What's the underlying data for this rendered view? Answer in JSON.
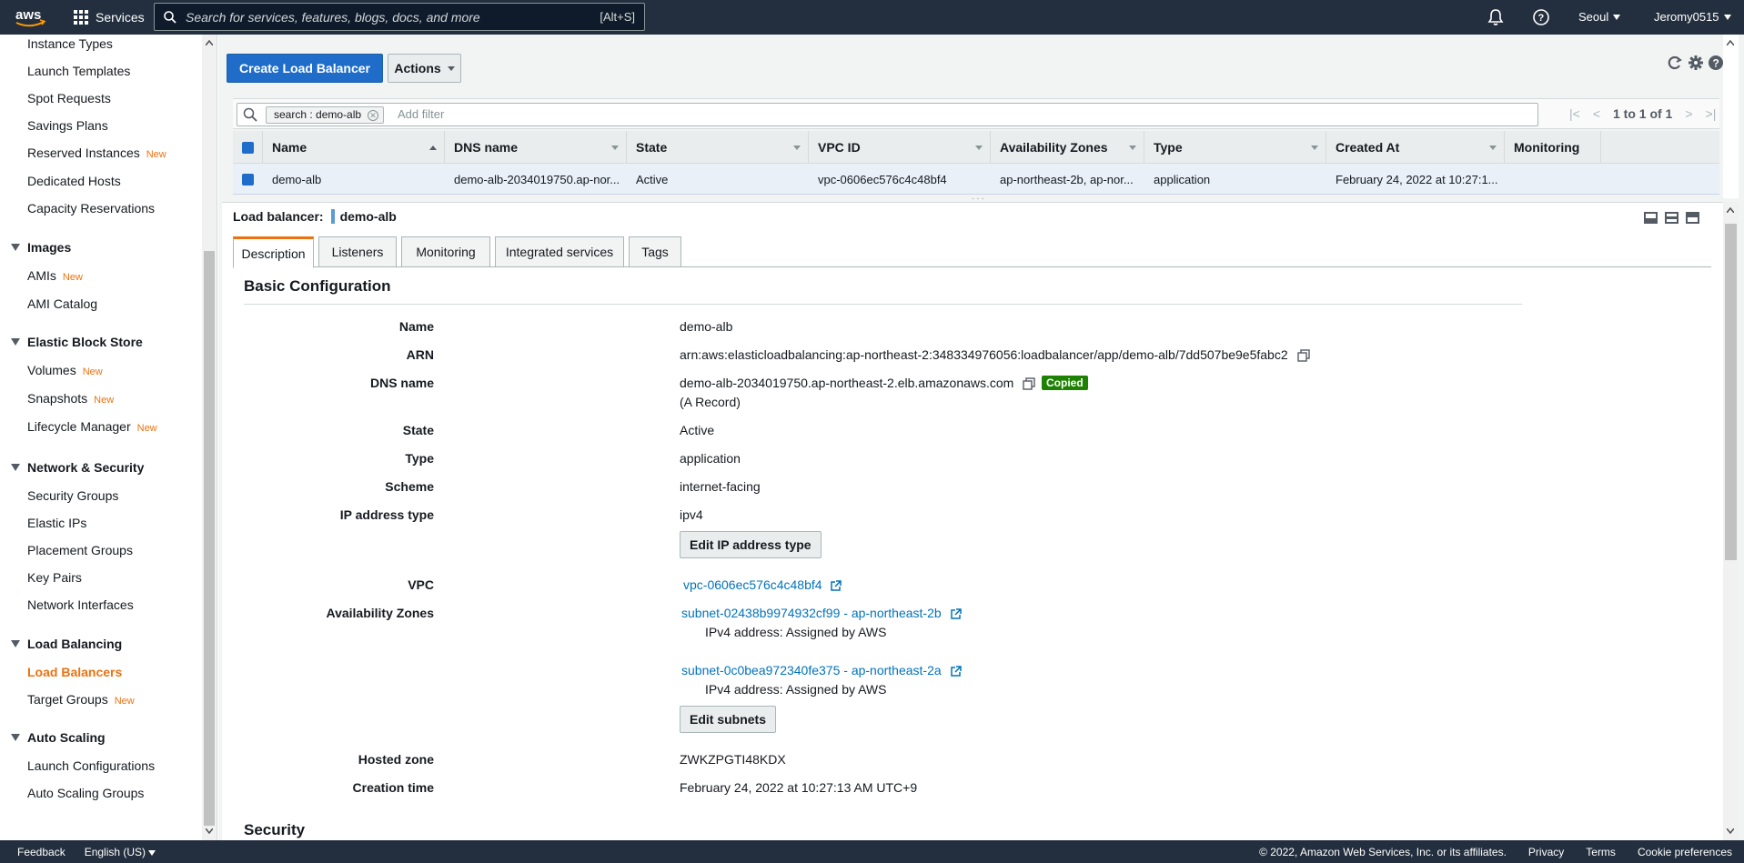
{
  "topnav": {
    "logo_text": "aws",
    "services_label": "Services",
    "search_placeholder": "Search for services, features, blogs, docs, and more",
    "search_shortcut": "[Alt+S]",
    "region": "Seoul",
    "account": "Jeromy0515"
  },
  "sidebar": {
    "new_badge": "New",
    "items": [
      {
        "label": "Instance Types",
        "new": false
      },
      {
        "label": "Launch Templates",
        "new": false
      },
      {
        "label": "Spot Requests",
        "new": false
      },
      {
        "label": "Savings Plans",
        "new": false
      },
      {
        "label": "Reserved Instances",
        "new": true
      },
      {
        "label": "Dedicated Hosts",
        "new": false
      },
      {
        "label": "Capacity Reservations",
        "new": false
      }
    ],
    "sections": {
      "images": {
        "title": "Images",
        "items": [
          {
            "label": "AMIs",
            "new": true
          },
          {
            "label": "AMI Catalog",
            "new": false
          }
        ]
      },
      "ebs": {
        "title": "Elastic Block Store",
        "items": [
          {
            "label": "Volumes",
            "new": true
          },
          {
            "label": "Snapshots",
            "new": true
          },
          {
            "label": "Lifecycle Manager",
            "new": true
          }
        ]
      },
      "network": {
        "title": "Network & Security",
        "items": [
          {
            "label": "Security Groups"
          },
          {
            "label": "Elastic IPs"
          },
          {
            "label": "Placement Groups"
          },
          {
            "label": "Key Pairs"
          },
          {
            "label": "Network Interfaces"
          }
        ]
      },
      "lb": {
        "title": "Load Balancing",
        "items": [
          {
            "label": "Load Balancers",
            "active": true
          },
          {
            "label": "Target Groups",
            "new": true
          }
        ]
      },
      "asg": {
        "title": "Auto Scaling",
        "items": [
          {
            "label": "Launch Configurations"
          },
          {
            "label": "Auto Scaling Groups"
          }
        ]
      }
    }
  },
  "toolbar": {
    "create_label": "Create Load Balancer",
    "actions_label": "Actions"
  },
  "filter": {
    "chip": "search : demo-alb",
    "placeholder": "Add filter",
    "pager_text": "1 to 1 of 1"
  },
  "table": {
    "columns": [
      "Name",
      "DNS name",
      "State",
      "VPC ID",
      "Availability Zones",
      "Type",
      "Created At",
      "Monitoring"
    ],
    "rows": [
      [
        "demo-alb",
        "demo-alb-2034019750.ap-nor...",
        "Active",
        "vpc-0606ec576c4c48bf4",
        "ap-northeast-2b, ap-nor...",
        "application",
        "February 24, 2022 at 10:27:1...",
        ""
      ]
    ]
  },
  "details": {
    "title_prefix": "Load balancer:",
    "title_name": "demo-alb",
    "tabs": [
      "Description",
      "Listeners",
      "Monitoring",
      "Integrated services",
      "Tags"
    ],
    "active_tab": "Description",
    "section_title": "Basic Configuration",
    "next_section": "Security",
    "labels": {
      "name": "Name",
      "arn": "ARN",
      "dns": "DNS name",
      "state": "State",
      "type": "Type",
      "scheme": "Scheme",
      "ip_type": "IP address type",
      "vpc": "VPC",
      "azs": "Availability Zones",
      "hosted_zone": "Hosted zone",
      "creation_time": "Creation time"
    },
    "values": {
      "name": "demo-alb",
      "arn": "arn:aws:elasticloadbalancing:ap-northeast-2:348334976056:loadbalancer/app/demo-alb/7dd507be9e5fabc2",
      "dns": "demo-alb-2034019750.ap-northeast-2.elb.amazonaws.com",
      "dns_copied": "Copied",
      "dns_record": "(A Record)",
      "state": "Active",
      "type": "application",
      "scheme": "internet-facing",
      "ip_type": "ipv4",
      "edit_ip_button": "Edit IP address type",
      "vpc": "vpc-0606ec576c4c48bf4",
      "subnet1": "subnet-02438b9974932cf99 - ap-northeast-2b",
      "subnet1_ip": "IPv4 address: Assigned by AWS",
      "subnet2": "subnet-0c0bea972340fe375 - ap-northeast-2a",
      "subnet2_ip": "IPv4 address: Assigned by AWS",
      "edit_subnets_button": "Edit subnets",
      "hosted_zone": "ZWKZPGTI48KDX",
      "creation_time": "February 24, 2022 at 10:27:13 AM UTC+9"
    }
  },
  "footer": {
    "feedback": "Feedback",
    "language": "English (US)",
    "copyright": "© 2022, Amazon Web Services, Inc. or its affiliates.",
    "privacy": "Privacy",
    "terms": "Terms",
    "cookies": "Cookie preferences"
  },
  "colors": {
    "nav_bg": "#232f3e",
    "primary": "#1f6dc9",
    "accent_orange": "#ec7211",
    "link": "#0073bb",
    "success": "#1d8102"
  }
}
